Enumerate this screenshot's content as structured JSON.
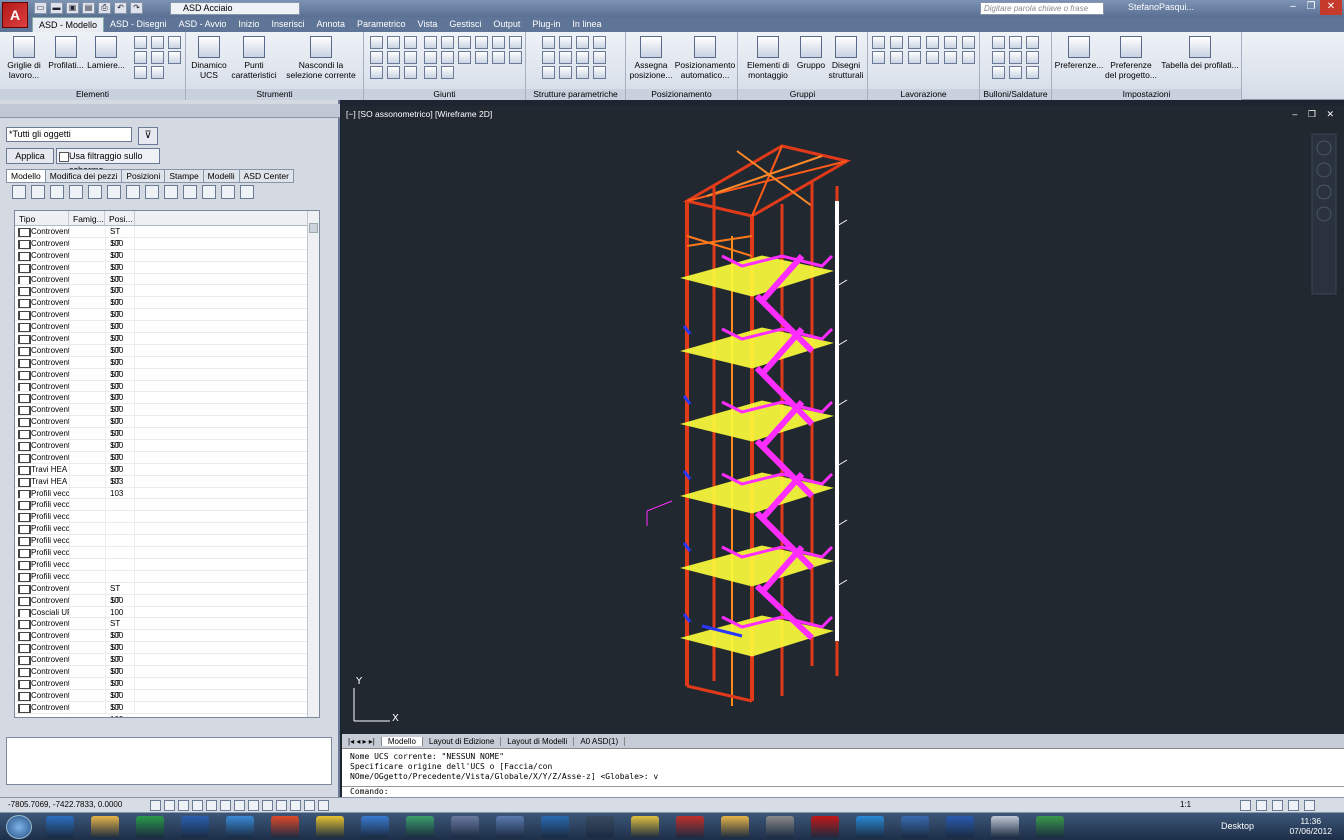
{
  "app": {
    "logo_letter": "A",
    "workspace": "ASD Acciaio",
    "search_placeholder": "Digitare parola chiave o frase",
    "user": "StefanoPasqui..."
  },
  "qat_icons": [
    "new-icon",
    "open-icon",
    "save-icon",
    "saveas-icon",
    "print-icon",
    "undo-icon",
    "redo-icon"
  ],
  "menu_tabs": [
    "ASD - Modello",
    "ASD - Disegni",
    "ASD - Avvio",
    "Inizio",
    "Inserisci",
    "Annota",
    "Parametrico",
    "Vista",
    "Gestisci",
    "Output",
    "Plug-in",
    "In linea"
  ],
  "ribbon": {
    "elementi": {
      "title": "Elementi",
      "b1": "Griglie di lavoro...",
      "b2": "Profilati...",
      "b3": "Lamiere..."
    },
    "strumenti": {
      "title": "Strumenti",
      "b1": "Dinamico UCS",
      "b2": "Punti caratteristici",
      "b3": "Nascondi la selezione corrente"
    },
    "giunti": {
      "title": "Giunti"
    },
    "strutture": {
      "title": "Strutture parametriche"
    },
    "posizionamento": {
      "title": "Posizionamento",
      "b1": "Assegna posizione...",
      "b2": "Posizionamento automatico..."
    },
    "gruppi": {
      "title": "Gruppi",
      "b1": "Elementi di montaggio",
      "b2": "Gruppo",
      "b3": "Disegni strutturali"
    },
    "lavorazione": {
      "title": "Lavorazione"
    },
    "bulloni": {
      "title": "Bulloni/Saldature"
    },
    "impostazioni": {
      "title": "Impostazioni",
      "b1": "Preferenze...",
      "b2": "Preferenze del progetto...",
      "b3": "Tabella dei profilati..."
    }
  },
  "left_panel": {
    "filter_value": "*Tutti gli oggetti",
    "apply_label": "Applica",
    "screen_filter_label": "Usa filtraggio sullo schermo",
    "tabs": [
      "Modello",
      "Modifica dei pezzi",
      "Posizioni",
      "Stampe",
      "Modelli",
      "ASD Center"
    ],
    "columns": [
      "Tipo",
      "Famig...",
      "Posi..."
    ],
    "rows": [
      [
        "Controvent",
        "",
        "ST 100"
      ],
      [
        "Controvent",
        "",
        "ST 100"
      ],
      [
        "Controvent",
        "",
        "ST 100"
      ],
      [
        "Controvent",
        "",
        "ST 100"
      ],
      [
        "Controvent",
        "",
        "ST 100"
      ],
      [
        "Controvent",
        "",
        "ST 100"
      ],
      [
        "Controvent",
        "",
        "ST 100"
      ],
      [
        "Controvent",
        "",
        "ST 100"
      ],
      [
        "Controvent",
        "",
        "ST 100"
      ],
      [
        "Controvent",
        "",
        "ST 100"
      ],
      [
        "Controvent",
        "",
        "ST 100"
      ],
      [
        "Controvent",
        "",
        "ST 100"
      ],
      [
        "Controvent",
        "",
        "ST 100"
      ],
      [
        "Controvent",
        "",
        "ST 100"
      ],
      [
        "Controvent",
        "",
        "ST 100"
      ],
      [
        "Controvent",
        "",
        "ST 100"
      ],
      [
        "Controvent",
        "",
        "ST 100"
      ],
      [
        "Controvent",
        "",
        "ST 100"
      ],
      [
        "Controvent",
        "",
        "ST 100"
      ],
      [
        "Controvent",
        "",
        "ST 100"
      ],
      [
        "Travi HEA",
        "",
        "ST 103"
      ],
      [
        "Travi HEA",
        "",
        "ST 103"
      ],
      [
        "Profili vecc",
        "",
        ""
      ],
      [
        "Profili vecc",
        "",
        ""
      ],
      [
        "Profili vecc",
        "",
        ""
      ],
      [
        "Profili vecc",
        "",
        ""
      ],
      [
        "Profili vecc",
        "",
        ""
      ],
      [
        "Profili vecc",
        "",
        ""
      ],
      [
        "Profili vecc",
        "",
        ""
      ],
      [
        "Profili vecc",
        "",
        ""
      ],
      [
        "Controvent",
        "",
        "ST 100"
      ],
      [
        "Controvent",
        "",
        "ST 100"
      ],
      [
        "Cosciali UF",
        "",
        ""
      ],
      [
        "Controvent",
        "",
        "ST 100"
      ],
      [
        "Controvent",
        "",
        "ST 100"
      ],
      [
        "Controvent",
        "",
        "ST 100"
      ],
      [
        "Controvent",
        "",
        "ST 100"
      ],
      [
        "Controvent",
        "",
        "ST 100"
      ],
      [
        "Controvent",
        "",
        "ST 100"
      ],
      [
        "Controvent",
        "",
        "ST 100"
      ],
      [
        "Controvent",
        "",
        "ST 100"
      ]
    ]
  },
  "viewport": {
    "label": "[−] [SO assonometrico] [Wireframe 2D]",
    "controls": "– ❐ ✕",
    "ucs_x": "X",
    "ucs_y": "Y"
  },
  "layout_tabs": [
    "Modello",
    "Layout di Edizione",
    "Layout di Modelli",
    "A0 ASD(1)"
  ],
  "command": {
    "lines": [
      "Nome UCS corrente: \"NESSUN NOME\"",
      "Specificare origine dell'UCS o [Faccia/con",
      "NOme/OGgetto/Precedente/Vista/Globale/X/Y/Z/Asse-z] <Globale>: v"
    ],
    "prompt": "Comando:"
  },
  "status": {
    "coords": "-7805.7069, -7422.7833, 0.0000",
    "scale": "1:1"
  },
  "taskbar": {
    "desktop": "Desktop",
    "time": "11:36",
    "date": "07/06/2012"
  },
  "colors": {
    "frame": "#e03a1a",
    "stairs": "#ff2dff",
    "deck": "#ffff3a",
    "column": "#ffffff",
    "viewport_bg": "#212830"
  }
}
